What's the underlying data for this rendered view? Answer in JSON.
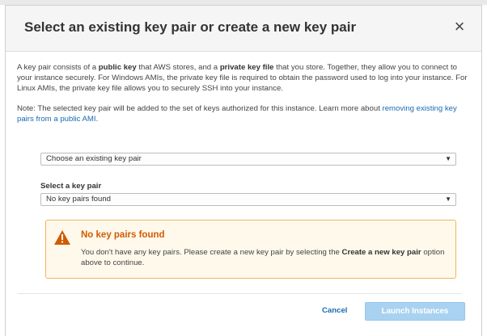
{
  "modal": {
    "title": "Select an existing key pair or create a new key pair",
    "close_label": "×",
    "intro": {
      "t1": "A key pair consists of a ",
      "b1": "public key",
      "t2": " that AWS stores, and a ",
      "b2": "private key file",
      "t3": " that you store. Together, they allow you to connect to your instance securely. For Windows AMIs, the private key file is required to obtain the password used to log into your instance. For Linux AMIs, the private key file allows you to securely SSH into your instance."
    },
    "note": {
      "t1": "Note: The selected key pair will be added to the set of keys authorized for this instance. Learn more about ",
      "link": "removing existing key pairs from a public AMI",
      "t2": "."
    },
    "choice_select": {
      "value": "Choose an existing key pair",
      "caret": "▼"
    },
    "key_pair": {
      "label": "Select a key pair",
      "value": "No key pairs found",
      "caret": "▼"
    },
    "alert": {
      "icon": "warning-icon",
      "title": "No key pairs found",
      "t1": "You don't have any key pairs. Please create a new key pair by selecting the ",
      "b1": "Create a new key pair",
      "t2": " option above to continue."
    },
    "buttons": {
      "cancel": "Cancel",
      "launch": "Launch Instances"
    }
  },
  "colors": {
    "link": "#1a6bb3",
    "alert_title": "#d15b00",
    "alert_border": "#f0b35c",
    "alert_bg": "#fff9ec",
    "launch_disabled": "#a9d2f1"
  }
}
